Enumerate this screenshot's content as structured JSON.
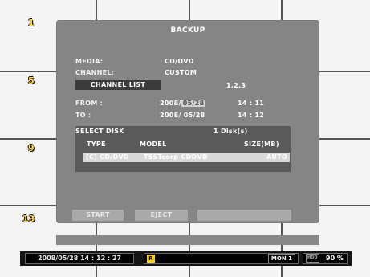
{
  "camera_numbers": [
    "1",
    "5",
    "9",
    "13"
  ],
  "dialog": {
    "title": "BACKUP",
    "media_label": "MEDIA:",
    "media_value": "CD/DVD",
    "channel_label": "CHANNEL:",
    "channel_value": "CUSTOM",
    "channel_list_button": "CHANNEL LIST",
    "channel_list_value": "1,2,3",
    "from_label": "FROM :",
    "from_date_prefix": "2008/",
    "from_date_selected": "05/28",
    "from_time": "14 : 11",
    "to_label": "TO :",
    "to_date": "2008/ 05/28",
    "to_time": "14 : 12",
    "select_disk_label": "SELECT DISK",
    "disk_count": "1 Disk(s)",
    "columns": {
      "type": "TYPE",
      "model": "MODEL",
      "size": "SIZE(MB)"
    },
    "disk_row": {
      "type": "[C] CD/DVD",
      "model": "TSSTcorp CDDVD",
      "size": "AUTO"
    },
    "buttons": {
      "start": "START",
      "eject": "EJECT"
    }
  },
  "status_bar": {
    "datetime": "2008/05/28 14 : 12 : 27",
    "record_indicator": "R",
    "monitor": "MON 1",
    "hdd_label": "HDD",
    "hdd_usage": "90 %",
    "record_color": "#ffd200"
  }
}
